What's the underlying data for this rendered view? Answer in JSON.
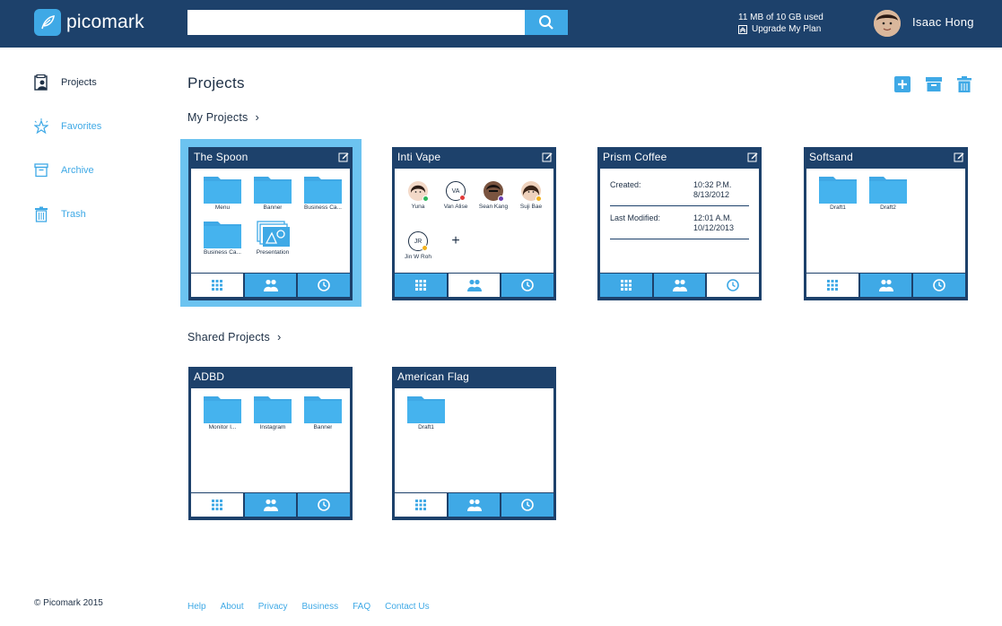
{
  "app": {
    "name": "picomark"
  },
  "search": {
    "placeholder": "",
    "value": ""
  },
  "account": {
    "usage": "11 MB of 10 GB used",
    "upgrade_label": "Upgrade My Plan",
    "user_name": "Isaac Hong"
  },
  "sidebar": {
    "items": [
      {
        "label": "Projects",
        "icon": "projects-icon"
      },
      {
        "label": "Favorites",
        "icon": "star-icon"
      },
      {
        "label": "Archive",
        "icon": "archive-icon"
      },
      {
        "label": "Trash",
        "icon": "trash-icon"
      }
    ]
  },
  "main": {
    "title": "Projects",
    "my_projects_label": "My Projects",
    "shared_projects_label": "Shared Projects",
    "my_projects": [
      {
        "name": "The Spoon",
        "view": "files",
        "items": [
          "Menu",
          "Banner",
          "Business Ca...",
          "Business Ca...",
          "Presentation"
        ]
      },
      {
        "name": "Inti Vape",
        "view": "people",
        "people": [
          {
            "name": "Yuna",
            "initials": "",
            "status": "#2eb85c"
          },
          {
            "name": "Van Alise",
            "initials": "VA",
            "status": "#e23b3b"
          },
          {
            "name": "Sean Kang",
            "initials": "",
            "status": "#6b3fb0"
          },
          {
            "name": "Suji Bae",
            "initials": "",
            "status": "#f2b11c"
          },
          {
            "name": "Jin W Roh",
            "initials": "JR",
            "status": "#f2b11c"
          }
        ],
        "add_label": "+"
      },
      {
        "name": "Prism Coffee",
        "view": "info",
        "created_label": "Created:",
        "created_value": "10:32 P.M. 8/13/2012",
        "modified_label": "Last Modified:",
        "modified_value": "12:01 A.M. 10/12/2013"
      },
      {
        "name": "Softsand",
        "view": "files",
        "items": [
          "Draft1",
          "Draft2"
        ]
      }
    ],
    "shared_projects": [
      {
        "name": "ADBD",
        "view": "files",
        "items": [
          "Monitor I...",
          "Instagram",
          "Banner"
        ]
      },
      {
        "name": "American Flag",
        "view": "files",
        "items": [
          "Draft1"
        ]
      }
    ]
  },
  "footer": {
    "copyright": "© Picomark 2015",
    "links": [
      "Help",
      "About",
      "Privacy",
      "Business",
      "FAQ",
      "Contact Us"
    ]
  },
  "colors": {
    "navy": "#1d416b",
    "accent": "#3fa9e6",
    "selected": "#6cc3f0"
  }
}
